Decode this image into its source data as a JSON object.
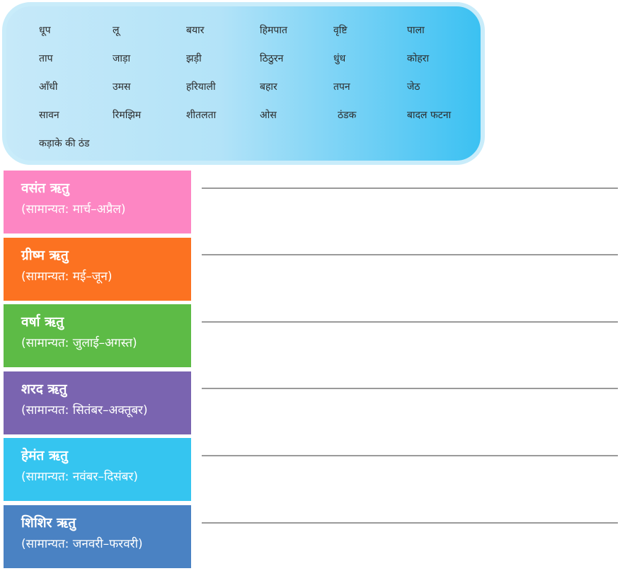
{
  "word_bank": [
    "धूप",
    "लू",
    "बयार",
    "हिमपात",
    "वृष्टि",
    "पाला",
    "ताप",
    "जाड़ा",
    "झड़ी",
    "ठिठुरन",
    "धुंध",
    "कोहरा",
    "आँधी",
    "उमस",
    "हरियाली",
    "बहार",
    "तपन",
    "जेठ",
    "सावन",
    "रिमझिम",
    "शीतलता",
    "ओस",
    "ठंडक",
    "बादल फटना",
    "कड़ाके की ठंड"
  ],
  "seasons": [
    {
      "name": "वसंत ऋतु",
      "months": "(सामान्यत: मार्च–अप्रैल)",
      "color": "#fd86c3"
    },
    {
      "name": "ग्रीष्म ऋतु",
      "months": "(सामान्यत: मई–जून)",
      "color": "#fc7221"
    },
    {
      "name": "वर्षा ऋतु",
      "months": "(सामान्यत: जुलाई–अगस्त)",
      "color": "#5dbb46"
    },
    {
      "name": "शरद ऋतु",
      "months": "(सामान्यत: सितंबर–अक्तूबर)",
      "color": "#7a64b0"
    },
    {
      "name": "हेमंत ऋतु",
      "months": "(सामान्यत: नवंबर–दिसंबर)",
      "color": "#35c5f0"
    },
    {
      "name": "शिशिर ऋतु",
      "months": "(सामान्यत: जनवरी–फरवरी)",
      "color": "#4a82c3"
    }
  ]
}
